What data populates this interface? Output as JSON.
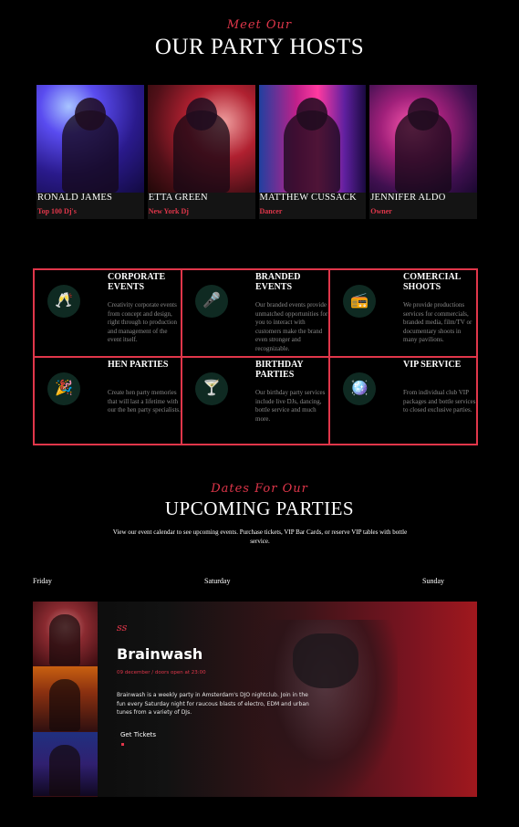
{
  "hosts_section": {
    "eyebrow": "Meet Our",
    "title": "OUR PARTY HOSTS",
    "hosts": [
      {
        "name": "RONALD JAMES",
        "role": "Top 100 Dj's"
      },
      {
        "name": "ETTA GREEN",
        "role": "New York Dj"
      },
      {
        "name": "MATTHEW CUSSACK",
        "role": "Dancer"
      },
      {
        "name": "JENNIFER ALDO",
        "role": "Owner"
      }
    ]
  },
  "services": [
    {
      "icon": "champagne-glasses-icon",
      "glyph": "🥂",
      "title": "CORPORATE EVENTS",
      "text": "Creativity corporate events from concept and design, right through to production and management of the event itself."
    },
    {
      "icon": "microphone-icon",
      "glyph": "🎤",
      "title": "BRANDED EVENTS",
      "text": "Our branded events provide unmatched opportunities for you to interact with customers make the brand even stronger and recognizable."
    },
    {
      "icon": "turntable-icon",
      "glyph": "📻",
      "title": "COMERCIAL SHOOTS",
      "text": "We provide productions services for commercials, branded media, film/TV or documentary shoots in many pavilions."
    },
    {
      "icon": "party-popper-icon",
      "glyph": "🎉",
      "title": "HEN PARTIES",
      "text": "Create hen party memories that will last a lifetime with our the hen party specialists."
    },
    {
      "icon": "cocktail-icon",
      "glyph": "🍸",
      "title": "BIRTHDAY PARTIES",
      "text": "Our birthday party services include live DJs, dancing, bottle service and much more."
    },
    {
      "icon": "disco-ball-icon",
      "glyph": "🪩",
      "title": "VIP SERVICE",
      "text": "From individual club VIP packages and bottle services to closed exclusive parties."
    }
  ],
  "parties_section": {
    "eyebrow": "Dates For Our",
    "title": "UPCOMING PARTIES",
    "description": "View our event calendar to see upcoming events. Purchase tickets, VIP Bar Cards, or reserve VIP tables with bottle service.",
    "days": [
      "Friday",
      "Saturday",
      "Sunday"
    ]
  },
  "event": {
    "logo": "ꜱꜱ",
    "title": "Brainwash",
    "date": "09 december / doors open at 23:00",
    "description": "Brainwash is a weekly party in Amsterdam's DJO nightclub. Join in the fun every Saturday night for raucous blasts of electro, EDM and urban tunes from a variety of DJs.",
    "button": "Get Tickets"
  },
  "colors": {
    "accent": "#e0364a",
    "background": "#000000",
    "icon_bg": "#0f2a22"
  }
}
